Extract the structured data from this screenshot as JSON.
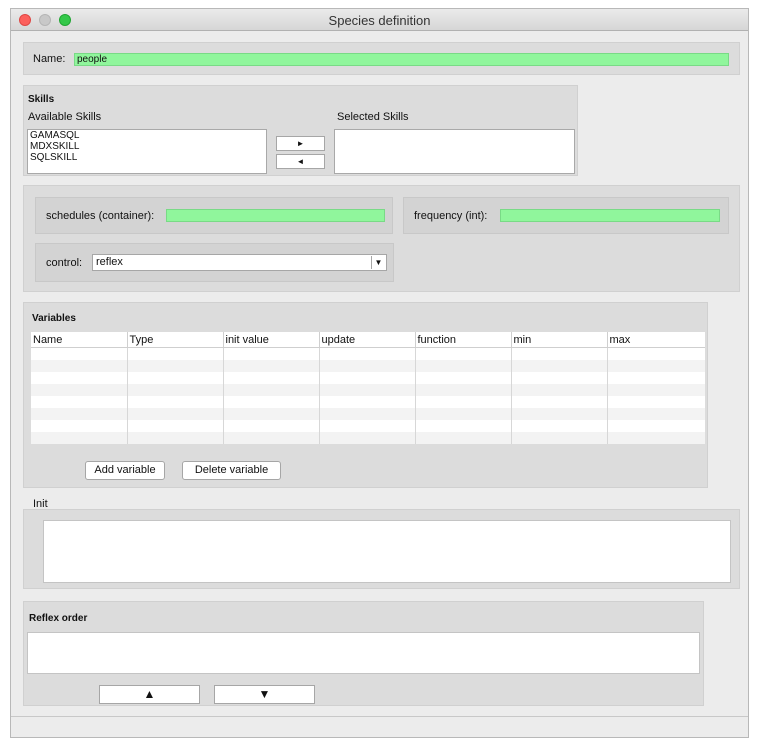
{
  "window": {
    "title": "Species definition"
  },
  "name_section": {
    "label": "Name:",
    "value": "people"
  },
  "skills": {
    "heading": "Skills",
    "available_label": "Available Skills",
    "selected_label": "Selected Skills",
    "available": [
      "GAMASQL",
      "MDXSKILL",
      "SQLSKILL"
    ],
    "selected": [],
    "add_glyph": "►",
    "remove_glyph": "◄"
  },
  "properties": {
    "schedules_label": "schedules (container):",
    "schedules_value": "",
    "frequency_label": "frequency (int):",
    "frequency_value": "",
    "control_label": "control:",
    "control_value": "reflex",
    "dropdown_glyph": "▼"
  },
  "variables": {
    "heading": "Variables",
    "columns": [
      "Name",
      "Type",
      "init value",
      "update",
      "function",
      "min",
      "max"
    ],
    "rows": [],
    "add_label": "Add variable",
    "delete_label": "Delete variable"
  },
  "init": {
    "label": "Init",
    "value": ""
  },
  "reflex_order": {
    "heading": "Reflex order",
    "items": [],
    "up_glyph": "▲",
    "down_glyph": "▼"
  },
  "colors": {
    "field_green": "#90f69c",
    "close": "#fc605c",
    "maximize": "#34c84a"
  }
}
